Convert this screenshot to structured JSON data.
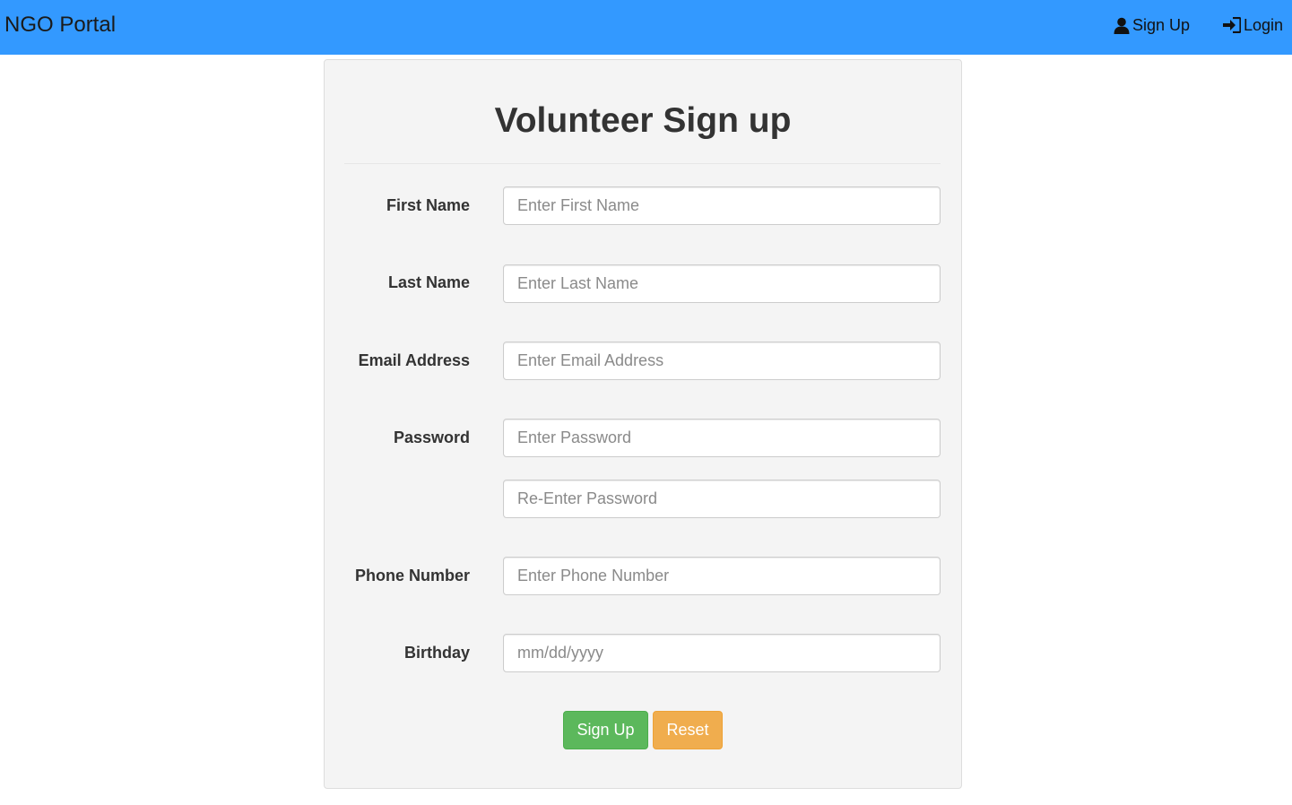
{
  "navbar": {
    "brand": "NGO Portal",
    "signup_label": "Sign Up",
    "login_label": "Login",
    "background": "#3399ff"
  },
  "form": {
    "title": "Volunteer Sign up",
    "first_name": {
      "label": "First Name",
      "placeholder": "Enter First Name",
      "value": ""
    },
    "last_name": {
      "label": "Last Name",
      "placeholder": "Enter Last Name",
      "value": ""
    },
    "email": {
      "label": "Email Address",
      "placeholder": "Enter Email Address",
      "value": ""
    },
    "password": {
      "label": "Password",
      "placeholder": "Enter Password",
      "value": ""
    },
    "reenter_password": {
      "placeholder": "Re-Enter Password",
      "value": ""
    },
    "phone": {
      "label": "Phone Number",
      "placeholder": "Enter Phone Number",
      "value": ""
    },
    "birthday": {
      "label": "Birthday",
      "placeholder": "mm/dd/yyyy",
      "value": ""
    },
    "signup_button": "Sign Up",
    "reset_button": "Reset",
    "colors": {
      "signup": "#5cb85c",
      "reset": "#f0ad4e"
    }
  },
  "icons": {
    "signup": "user-icon",
    "login": "log-in-icon"
  }
}
